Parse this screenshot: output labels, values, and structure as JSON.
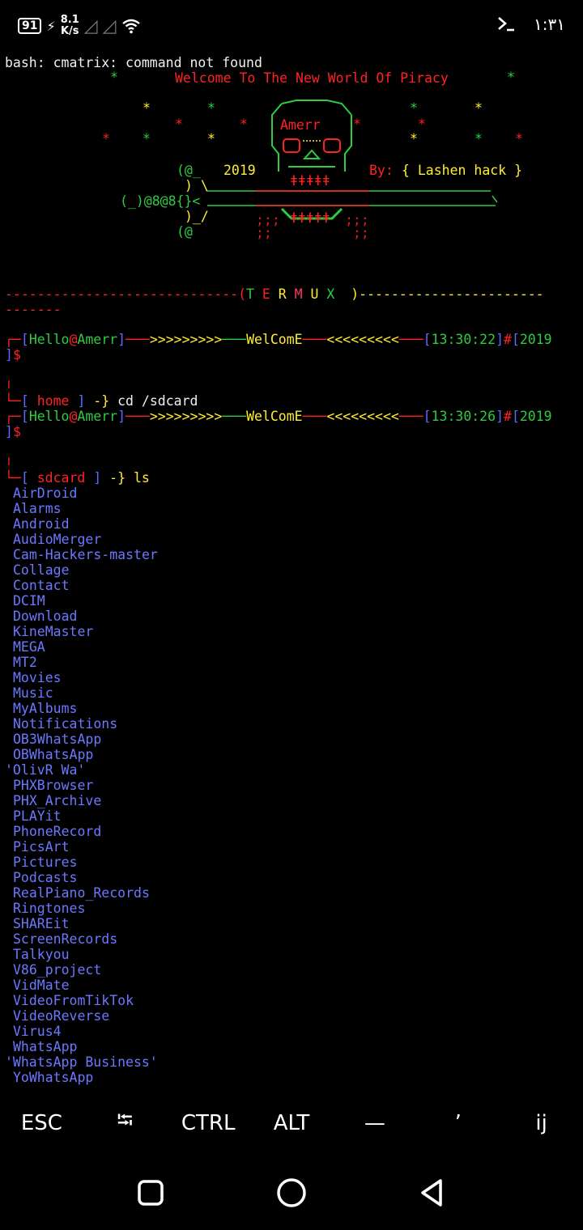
{
  "status_bar": {
    "battery": "91",
    "net_speed_value": "8.1",
    "net_speed_unit": "K/s",
    "terminal_icon": "terminal-icon",
    "time": "١:٣١"
  },
  "terminal": {
    "error_line": "bash: cmatrix: command not found",
    "banner_welcome": "Welcome To The New World Of Piracy",
    "skull_name": "Amerr",
    "year": "2019",
    "by_label": "By:",
    "author": "{ Lashen hack }",
    "art_left1": "(@_",
    "art_left2": ") \\",
    "art_left3": "(_)@8@8{}<",
    "art_left4": ")_/",
    "art_left5": "(@",
    "termux_divider_left": "-----------------------------(",
    "termux_letters": [
      "T",
      "E",
      "R",
      "M",
      "U",
      "X"
    ],
    "termux_divider_right": ")-----------------------",
    "termux_divider_wrap": "-------",
    "prompt1": {
      "user": "Hello",
      "host": "Amerr",
      "arrows_right": ">>>>>>>>>",
      "welcome": "WelComE",
      "arrows_left": "<<<<<<<<<",
      "time": "13:30:22",
      "hash": "#",
      "year": "2019",
      "dollar": "$",
      "dir": "home",
      "cmd": "cd /sdcard"
    },
    "prompt2": {
      "user": "Hello",
      "host": "Amerr",
      "arrows_right": ">>>>>>>>>",
      "welcome": "WelComE",
      "arrows_left": "<<<<<<<<<",
      "time": "13:30:26",
      "hash": "#",
      "year": "2019",
      "dollar": "$",
      "dir": "sdcard",
      "cmd": "ls"
    },
    "ls_output": [
      "AirDroid",
      "Alarms",
      "Android",
      "AudioMerger",
      "Cam-Hackers-master",
      "Collage",
      "Contact",
      "DCIM",
      "Download",
      "KineMaster",
      "MEGA",
      "MT2",
      "Movies",
      "Music",
      "MyAlbums",
      "Notifications",
      "OB3WhatsApp",
      "OBWhatsApp",
      "'OlivR Wa'",
      "PHXBrowser",
      "PHX_Archive",
      "PLAYit",
      "PhoneRecord",
      "PicsArt",
      "Pictures",
      "Podcasts",
      "RealPiano_Records",
      "Ringtones",
      "SHAREit",
      "ScreenRecords",
      "Talkyou",
      "V86_project",
      "VidMate",
      "VideoFromTikTok",
      "VideoReverse",
      "Virus4",
      "WhatsApp",
      "'WhatsApp Business'",
      "YoWhatsApp"
    ]
  },
  "extra_keys": [
    "ESC",
    "⭾",
    "CTRL",
    "ALT",
    "—",
    "’",
    "ij"
  ],
  "nav": {
    "recents_icon": "square-icon",
    "home_icon": "circle-icon",
    "back_icon": "triangle-back-icon"
  },
  "colors": {
    "background": "#000000",
    "green": "#2ecc40",
    "red": "#ff2222",
    "yellow": "#ffee33",
    "blue": "#5a6bff"
  }
}
